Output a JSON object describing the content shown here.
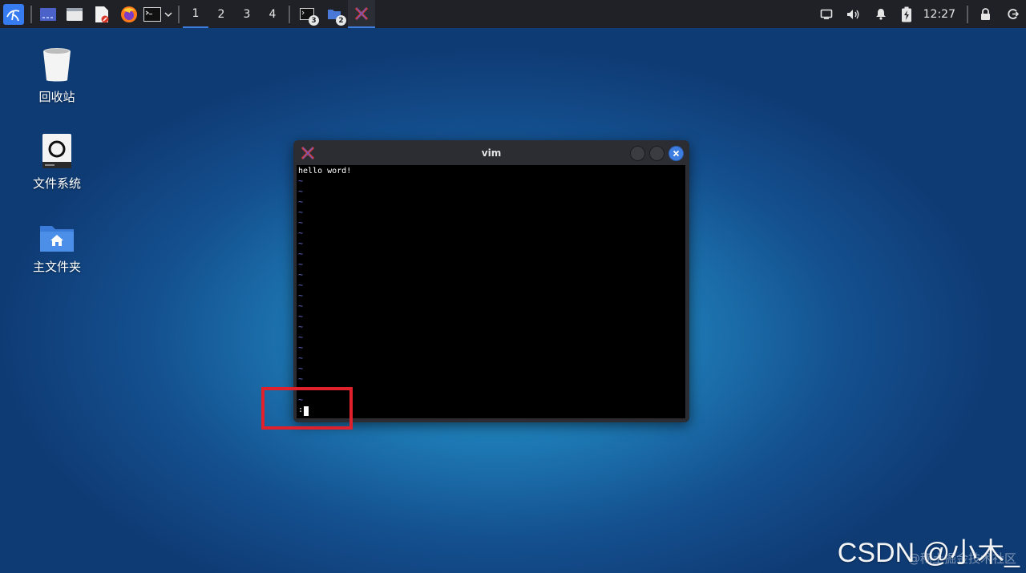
{
  "taskbar": {
    "workspaces": [
      "1",
      "2",
      "3",
      "4"
    ],
    "active_workspace": "1",
    "task_badges": [
      "3",
      "2"
    ],
    "clock": "12:27",
    "icons": [
      "kali-menu-icon",
      "desktop-icon",
      "file-manager-icon",
      "text-editor-icon",
      "firefox-icon",
      "terminal-icon",
      "chevron-down-icon",
      "terminal-task-icon",
      "folder-task-icon",
      "vim-task-icon",
      "display-icon",
      "volume-icon",
      "bell-icon",
      "battery-icon",
      "lock-icon",
      "logout-icon"
    ]
  },
  "desktop": {
    "icons": [
      {
        "label": "回收站",
        "icon": "trash-icon"
      },
      {
        "label": "文件系统",
        "icon": "filesystem-icon"
      },
      {
        "label": "主文件夹",
        "icon": "home-folder-icon"
      }
    ]
  },
  "window": {
    "title": "vim",
    "first_line": "hello word!",
    "tilde": "~",
    "command": ":"
  },
  "watermark": {
    "main": "CSDN @小木_",
    "sub": "@稀土掘金技术社区"
  },
  "colors": {
    "accent": "#3d7ee0",
    "highlight": "#e0202a",
    "tilde": "#6f7ce8"
  }
}
